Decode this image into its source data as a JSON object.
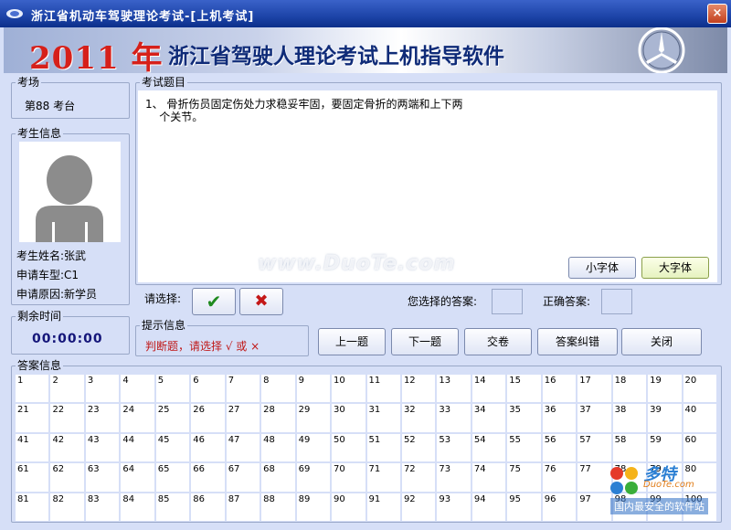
{
  "window": {
    "title": "浙江省机动车驾驶理论考试-[上机考试]",
    "close_glyph": "×"
  },
  "banner": {
    "year": "2011 年",
    "title": "浙江省驾驶人理论考试上机指导软件"
  },
  "venue": {
    "label": "考场",
    "value": "第88 考台"
  },
  "candidate": {
    "label": "考生信息",
    "name_label": "考生姓名:",
    "name": "张武",
    "vehicle_label": "申请车型:",
    "vehicle": "C1",
    "reason_label": "申请原因:",
    "reason": "新学员"
  },
  "time": {
    "label": "剩余时间",
    "value": "00:00:00"
  },
  "question": {
    "label": "考试题目",
    "text": "1、 骨折伤员固定伤处力求稳妥牢固，要固定骨折的两端和上下两\n    个关节。",
    "font_small": "小字体",
    "font_large": "大字体"
  },
  "answer_controls": {
    "choose_label": "请选择:",
    "correct_glyph": "✔",
    "wrong_glyph": "✖",
    "selected_label": "您选择的答案:",
    "selected_value": "",
    "correct_label": "正确答案:",
    "correct_value": ""
  },
  "hint": {
    "label": "提示信息",
    "text": "判断题，请选择 √ 或 ×"
  },
  "nav": {
    "prev": "上一题",
    "next": "下一题",
    "submit": "交卷",
    "correct_answer": "答案纠错",
    "close": "关闭"
  },
  "answers": {
    "label": "答案信息",
    "cells": [
      "1",
      "2",
      "3",
      "4",
      "5",
      "6",
      "7",
      "8",
      "9",
      "10",
      "11",
      "12",
      "13",
      "14",
      "15",
      "16",
      "17",
      "18",
      "19",
      "20",
      "21",
      "22",
      "23",
      "24",
      "25",
      "26",
      "27",
      "28",
      "29",
      "30",
      "31",
      "32",
      "33",
      "34",
      "35",
      "36",
      "37",
      "38",
      "39",
      "40",
      "41",
      "42",
      "43",
      "44",
      "45",
      "46",
      "47",
      "48",
      "49",
      "50",
      "51",
      "52",
      "53",
      "54",
      "55",
      "56",
      "57",
      "58",
      "59",
      "60",
      "61",
      "62",
      "63",
      "64",
      "65",
      "66",
      "67",
      "68",
      "69",
      "70",
      "71",
      "72",
      "73",
      "74",
      "75",
      "76",
      "77",
      "78",
      "79",
      "80",
      "81",
      "82",
      "83",
      "84",
      "85",
      "86",
      "87",
      "88",
      "89",
      "90",
      "91",
      "92",
      "93",
      "94",
      "95",
      "96",
      "97",
      "98",
      "99",
      "100"
    ]
  },
  "watermark": {
    "text": "www.DuoTe.com"
  },
  "corner_logo": {
    "line1": "多特",
    "line2": "DuoTe.com",
    "line3": "国内最安全的软件站"
  },
  "colors": {
    "title_bar": "#1d44a8",
    "panel_bg": "#d6dff7",
    "hint_red": "#c01818",
    "timer_blue": "#15167a",
    "banner_red": "#d6201a"
  }
}
